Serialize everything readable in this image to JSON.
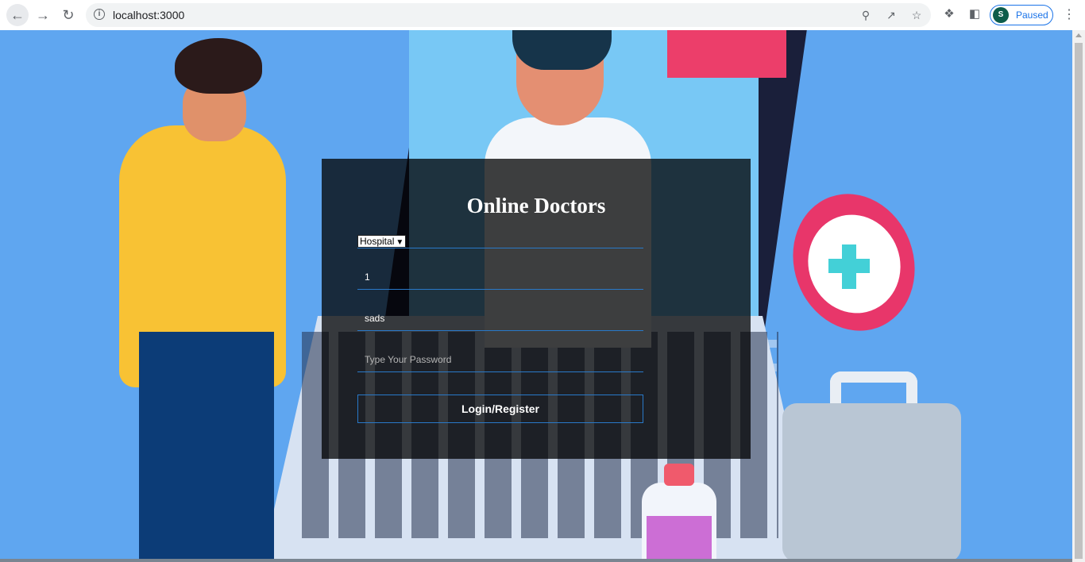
{
  "browser": {
    "url": "localhost:3000",
    "profile_initial": "S",
    "profile_status": "Paused",
    "icons": {
      "back": "arrow-left-icon",
      "forward": "arrow-right-icon",
      "reload": "reload-icon",
      "info": "info-icon",
      "zoom": "zoom-icon",
      "share": "share-icon",
      "bookmark": "star-icon",
      "extensions": "puzzle-icon",
      "sidepanel": "side-panel-icon",
      "menu": "more-vert-icon"
    }
  },
  "login": {
    "title": "Online Doctors",
    "role_select": "Hospital",
    "field1_value": "1",
    "field2_value": "sads",
    "password_placeholder": "Type Your Password",
    "submit_label": "Login/Register"
  }
}
